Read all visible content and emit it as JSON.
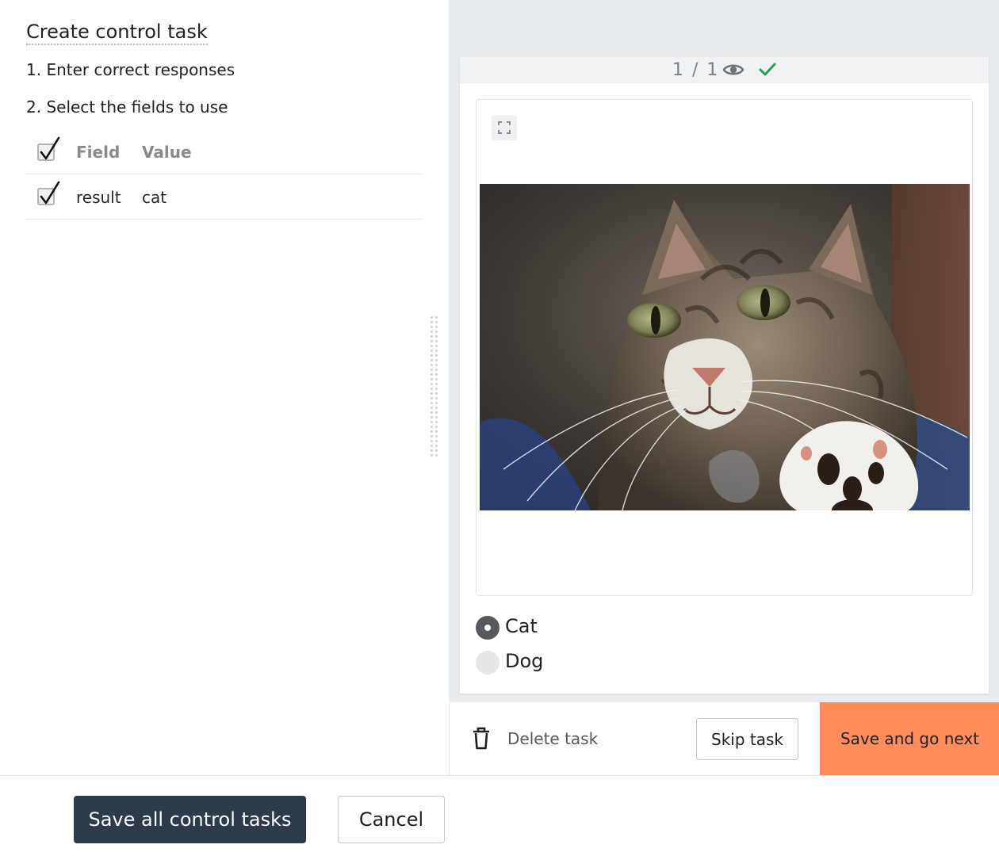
{
  "left": {
    "title": "Create control task",
    "step1": "1. Enter correct responses",
    "step2": "2. Select the fields to use",
    "table": {
      "header": {
        "field": "Field",
        "value": "Value",
        "checked": true
      },
      "rows": [
        {
          "field": "result",
          "value": "cat",
          "checked": true
        }
      ]
    }
  },
  "task": {
    "counter": "1 / 1",
    "icons": {
      "view": "eye-icon",
      "status": "check-icon",
      "expand": "expand-icon"
    },
    "image": "tabby cat photo",
    "options": [
      {
        "label": "Cat",
        "selected": true
      },
      {
        "label": "Dog",
        "selected": false
      }
    ]
  },
  "actions": {
    "delete_label": "Delete task",
    "skip_label": "Skip task",
    "next_label": "Save and go next"
  },
  "footer": {
    "save_all_label": "Save all control tasks",
    "cancel_label": "Cancel"
  },
  "colors": {
    "primary_dark": "#2d3a4a",
    "accent_orange": "#ff8c5b",
    "success_green": "#1fa34a",
    "panel_gray": "#e9ecef"
  }
}
